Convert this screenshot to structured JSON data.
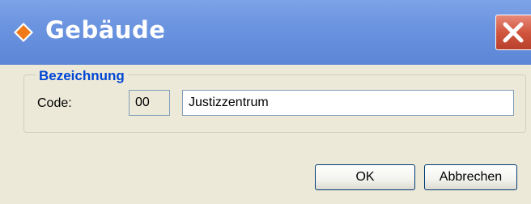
{
  "window": {
    "title": "Gebäude",
    "title_icon": "orange-diamond-icon",
    "close_icon": "close-x-icon",
    "colors": {
      "titlebar": "#6b94e0",
      "close_button": "#d1563f",
      "accent_label": "#0046d5",
      "background": "#ece9d8"
    }
  },
  "group": {
    "legend": "Bezeichnung"
  },
  "form": {
    "code_label": "Code:",
    "code_value": "00",
    "name_value": "Justizzentrum"
  },
  "buttons": {
    "ok_label": "OK",
    "cancel_label": "Abbrechen"
  }
}
